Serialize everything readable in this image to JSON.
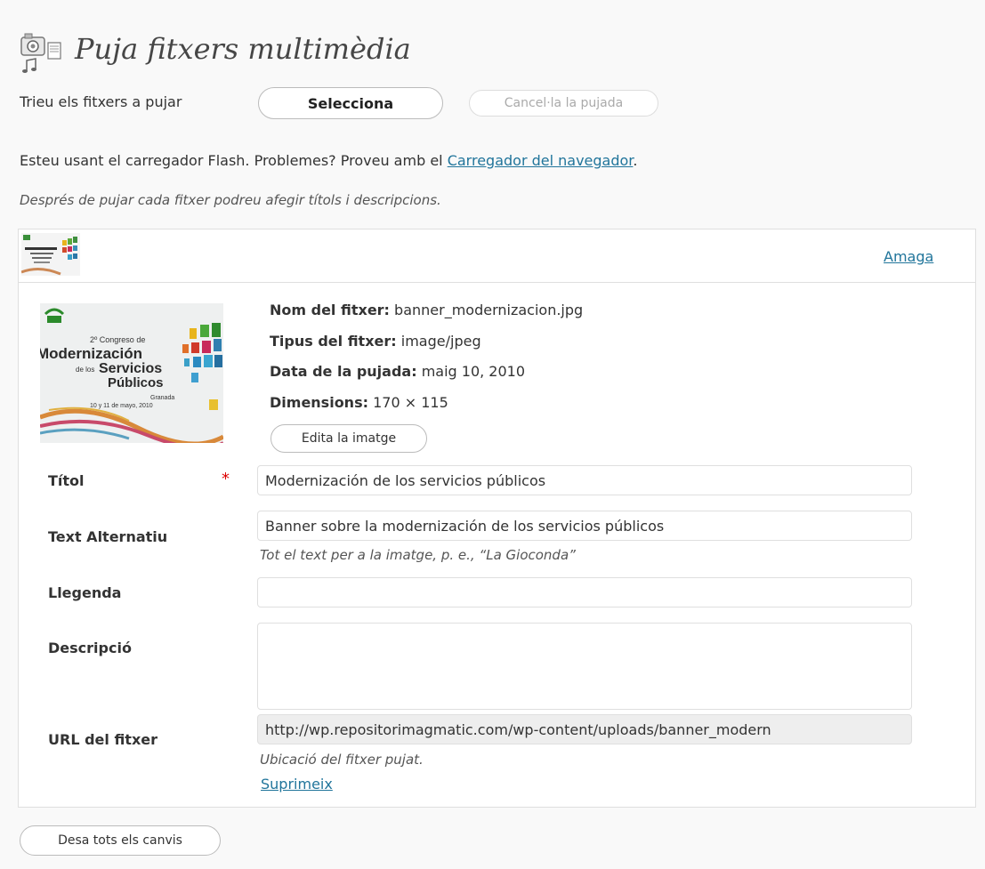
{
  "header": {
    "title": "Puja fitxers multimèdia",
    "icon": "camera-media-icon"
  },
  "upload": {
    "choose_label": "Trieu els fitxers a pujar",
    "select_button": "Selecciona",
    "cancel_button": "Cancel·la la pujada",
    "flash_text": "Esteu usant el carregador Flash. Problemes? Proveu amb el ",
    "browser_uploader_link": "Carregador del navegador",
    "flash_text_end": ".",
    "after_upload_note": "Després de pujar cada fitxer podreu afegir títols i descripcions."
  },
  "media_item": {
    "hide_link": "Amaga",
    "thumbnail": {
      "line1": "2º Congreso de",
      "line2": "Modernización",
      "line3": "de los",
      "line4": "Servicios",
      "line5": "Públicos",
      "line6": "Granada",
      "line7": "10 y 11 de mayo, 2010"
    },
    "meta": {
      "file_name_label": "Nom del fitxer:",
      "file_name": "banner_modernizacion.jpg",
      "file_type_label": "Tipus del fitxer:",
      "file_type": "image/jpeg",
      "upload_date_label": "Data de la pujada:",
      "upload_date": "maig 10, 2010",
      "dimensions_label": "Dimensions:",
      "dimensions": "170 × 115"
    },
    "edit_image_button": "Edita la imatge",
    "fields": {
      "title_label": "Títol",
      "title_required": "*",
      "title_value": "Modernización de los servicios públicos",
      "alt_label": "Text Alternatiu",
      "alt_value": "Banner sobre la modernización de los servicios públicos",
      "alt_help": "Tot el text per a la imatge, p. e., “La Gioconda”",
      "caption_label": "Llegenda",
      "caption_value": "",
      "description_label": "Descripció",
      "description_value": "",
      "url_label": "URL del fitxer",
      "url_value": "http://wp.repositorimagmatic.com/wp-content/uploads/banner_modern",
      "url_help": "Ubicació del fitxer pujat."
    },
    "delete_link": "Suprimeix"
  },
  "footer": {
    "save_all_button": "Desa tots els canvis"
  },
  "colors": {
    "link": "#21759b",
    "required": "#dd0000",
    "background": "#f9f9f9"
  }
}
